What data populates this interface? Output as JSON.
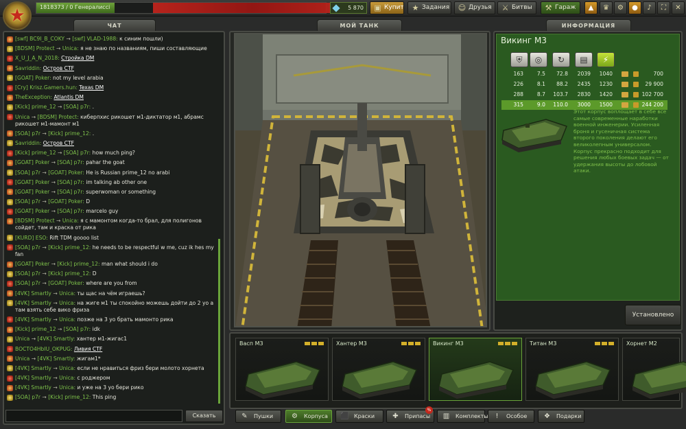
{
  "topbar": {
    "xp_text": "1818373 / 0 Генералиссі",
    "xp_progress": 0.27,
    "crystals": "5 870",
    "buttons": {
      "buy": "Купить",
      "missions": "Задания",
      "friends": "Друзья",
      "battles": "Битвы",
      "garage": "Гараж"
    },
    "icons": [
      "mission-icon",
      "star-icon",
      "friends-icon",
      "battles-icon",
      "garage-icon"
    ]
  },
  "tabs": {
    "chat": "ЧАТ",
    "my_tank": "МОЙ ТАНК",
    "info": "ИНФОРМАЦИЯ"
  },
  "chat": {
    "messages": [
      {
        "from": "[swf] BC9I_B_COKY",
        "to": "[swf] VLAD-1988",
        "text": "к синим пошли)"
      },
      {
        "from": "[BDSM] Protect",
        "to": "Unica",
        "text": "я не знаю по названиям, пиши составляющие"
      },
      {
        "from": "X_U_J_A_N_2018",
        "to": "",
        "text": "Стройка DM",
        "link": true
      },
      {
        "from": "Savriddin",
        "to": "",
        "text": "Остров CTF",
        "link": true
      },
      {
        "from": "[GOAT] Poker",
        "to": "",
        "text": "not my level arabia"
      },
      {
        "from": "[Cry] Krisz.Gamers.hun",
        "to": "",
        "text": "Texas DM",
        "link": true
      },
      {
        "from": "TheException",
        "to": "",
        "text": "Atlantis DM",
        "link": true
      },
      {
        "from": "[Kick] prime_12",
        "to": "[SOA] p7r",
        "text": "."
      },
      {
        "from": "Unica",
        "to": "[BDSM] Protect",
        "text": "киберпхис рикошет м1-диктатор м1, абрамс рикошет м1-мамонт м1"
      },
      {
        "from": "[SOA] p7r",
        "to": "[Kick] prime_12",
        "text": "."
      },
      {
        "from": "Savriddin",
        "to": "",
        "text": "Остров CTF",
        "link": true
      },
      {
        "from": "[Kick] prime_12",
        "to": "[SOA] p7r",
        "text": "how much ping?"
      },
      {
        "from": "[GOAT] Poker",
        "to": "[SOA] p7r",
        "text": "pahar the goat"
      },
      {
        "from": "[SOA] p7r",
        "to": "[GOAT] Poker",
        "text": "He is Russian prime_12 no arabi"
      },
      {
        "from": "[GOAT] Poker",
        "to": "[SOA] p7r",
        "text": "im talking ab other one"
      },
      {
        "from": "[GOAT] Poker",
        "to": "[SOA] p7r",
        "text": "superwoman or something"
      },
      {
        "from": "[SOA] p7r",
        "to": "[GOAT] Poker",
        "text": "D"
      },
      {
        "from": "[GOAT] Poker",
        "to": "[SOA] p7r",
        "text": "marcelo guy"
      },
      {
        "from": "[BDSM] Protect",
        "to": "Unica",
        "text": "я с мамонтом когда-то брал, для полигонов сойдет, там и краска от рика"
      },
      {
        "from": "[KURD] ESO",
        "to": "",
        "text": "Rift TDM goooo list",
        "link_part": "Rift TDM"
      },
      {
        "from": "[SOA] p7r",
        "to": "[Kick] prime_12",
        "text": "he needs to be respectful w me, cuz ik hes my fan"
      },
      {
        "from": "[GOAT] Poker",
        "to": "[Kick] prime_12",
        "text": "man what should i do"
      },
      {
        "from": "[SOA] p7r",
        "to": "[Kick] prime_12",
        "text": "D"
      },
      {
        "from": "[SOA] p7r",
        "to": "[GOAT] Poker",
        "text": "where are you from"
      },
      {
        "from": "[4VK] Smartly",
        "to": "Unica",
        "text": "ты щас на чём играешь?"
      },
      {
        "from": "[4VK] Smartly",
        "to": "Unica",
        "text": "на жиге м1 ты спокойно можешь дойти до 2 уо а там взять себе вико фриза"
      },
      {
        "from": "[4VK] Smartly",
        "to": "Unica",
        "text": "позже на 3 уо брать мамонто рика"
      },
      {
        "from": "[Kick] prime_12",
        "to": "[SOA] p7r",
        "text": "idk"
      },
      {
        "from": "Unica",
        "to": "[4VK] Smartly",
        "text": "хантер м1-жигас1"
      },
      {
        "from": "BOCTO4HbIU_OKPUG",
        "to": "",
        "text": "Ливия CTF",
        "link": true
      },
      {
        "from": "Unica",
        "to": "[4VK] Smartly",
        "text": "жигам1*"
      },
      {
        "from": "[4VK] Smartly",
        "to": "Unica",
        "text": "если не нравиться фриз бери молото хорнета"
      },
      {
        "from": "[4VK] Smartly",
        "to": "Unica",
        "text": "с роджером"
      },
      {
        "from": "[4VK] Smartly",
        "to": "Unica",
        "text": "и уже на 3 уо бери рико"
      },
      {
        "from": "[SOA] p7r",
        "to": "[Kick] prime_12",
        "text": "This ping"
      }
    ],
    "send_label": "Сказать",
    "input_value": ""
  },
  "info": {
    "title": "Викинг М3",
    "stat_icons": [
      "armor-icon",
      "speed-icon",
      "turn-icon",
      "weight-icon",
      "power-icon"
    ],
    "rows": [
      {
        "v": [
          "163",
          "7.5",
          "72.8",
          "2039",
          "1040"
        ],
        "price": "700",
        "active": false
      },
      {
        "v": [
          "226",
          "8.1",
          "88.2",
          "2435",
          "1230"
        ],
        "price": "29 900",
        "active": false
      },
      {
        "v": [
          "288",
          "8.7",
          "103.7",
          "2830",
          "1420"
        ],
        "price": "102 700",
        "active": false
      },
      {
        "v": [
          "315",
          "9.0",
          "110.0",
          "3000",
          "1500"
        ],
        "price": "244 200",
        "active": true
      }
    ],
    "description": "Этот корпус воплощает в себе все самые современные наработки военной инженерии. Усиленная броня и гусеничная система второго поколения делают его великолепным универсалом. Корпус прекрасно подходит для решения любых боевых задач — от удержания высоты до лобовой атаки.",
    "install_label": "Установлено"
  },
  "items": [
    {
      "name": "Васп М3",
      "selected": false
    },
    {
      "name": "Хантер М3",
      "selected": false
    },
    {
      "name": "Викинг М3",
      "selected": true
    },
    {
      "name": "Титан М3",
      "selected": false
    },
    {
      "name": "Хорнет М2",
      "selected": false
    }
  ],
  "categories": [
    {
      "label": "Пушки",
      "icon": "gun-icon",
      "selected": false
    },
    {
      "label": "Корпуса",
      "icon": "hull-icon",
      "selected": true
    },
    {
      "label": "Краски",
      "icon": "paint-icon",
      "selected": false
    },
    {
      "label": "Припасы",
      "icon": "supplies-icon",
      "selected": false
    },
    {
      "label": "Комплекты",
      "icon": "kits-icon",
      "selected": false
    },
    {
      "label": "Особое",
      "icon": "special-icon",
      "selected": false
    },
    {
      "label": "Подарки",
      "icon": "gift-icon",
      "selected": false
    }
  ],
  "supplies_badge": "%",
  "colors": {
    "accent_green": "#6aa43a",
    "nick_green": "#7ec24a",
    "desc_green": "#7fc04a",
    "panel_bg": "#1c1f1c"
  }
}
